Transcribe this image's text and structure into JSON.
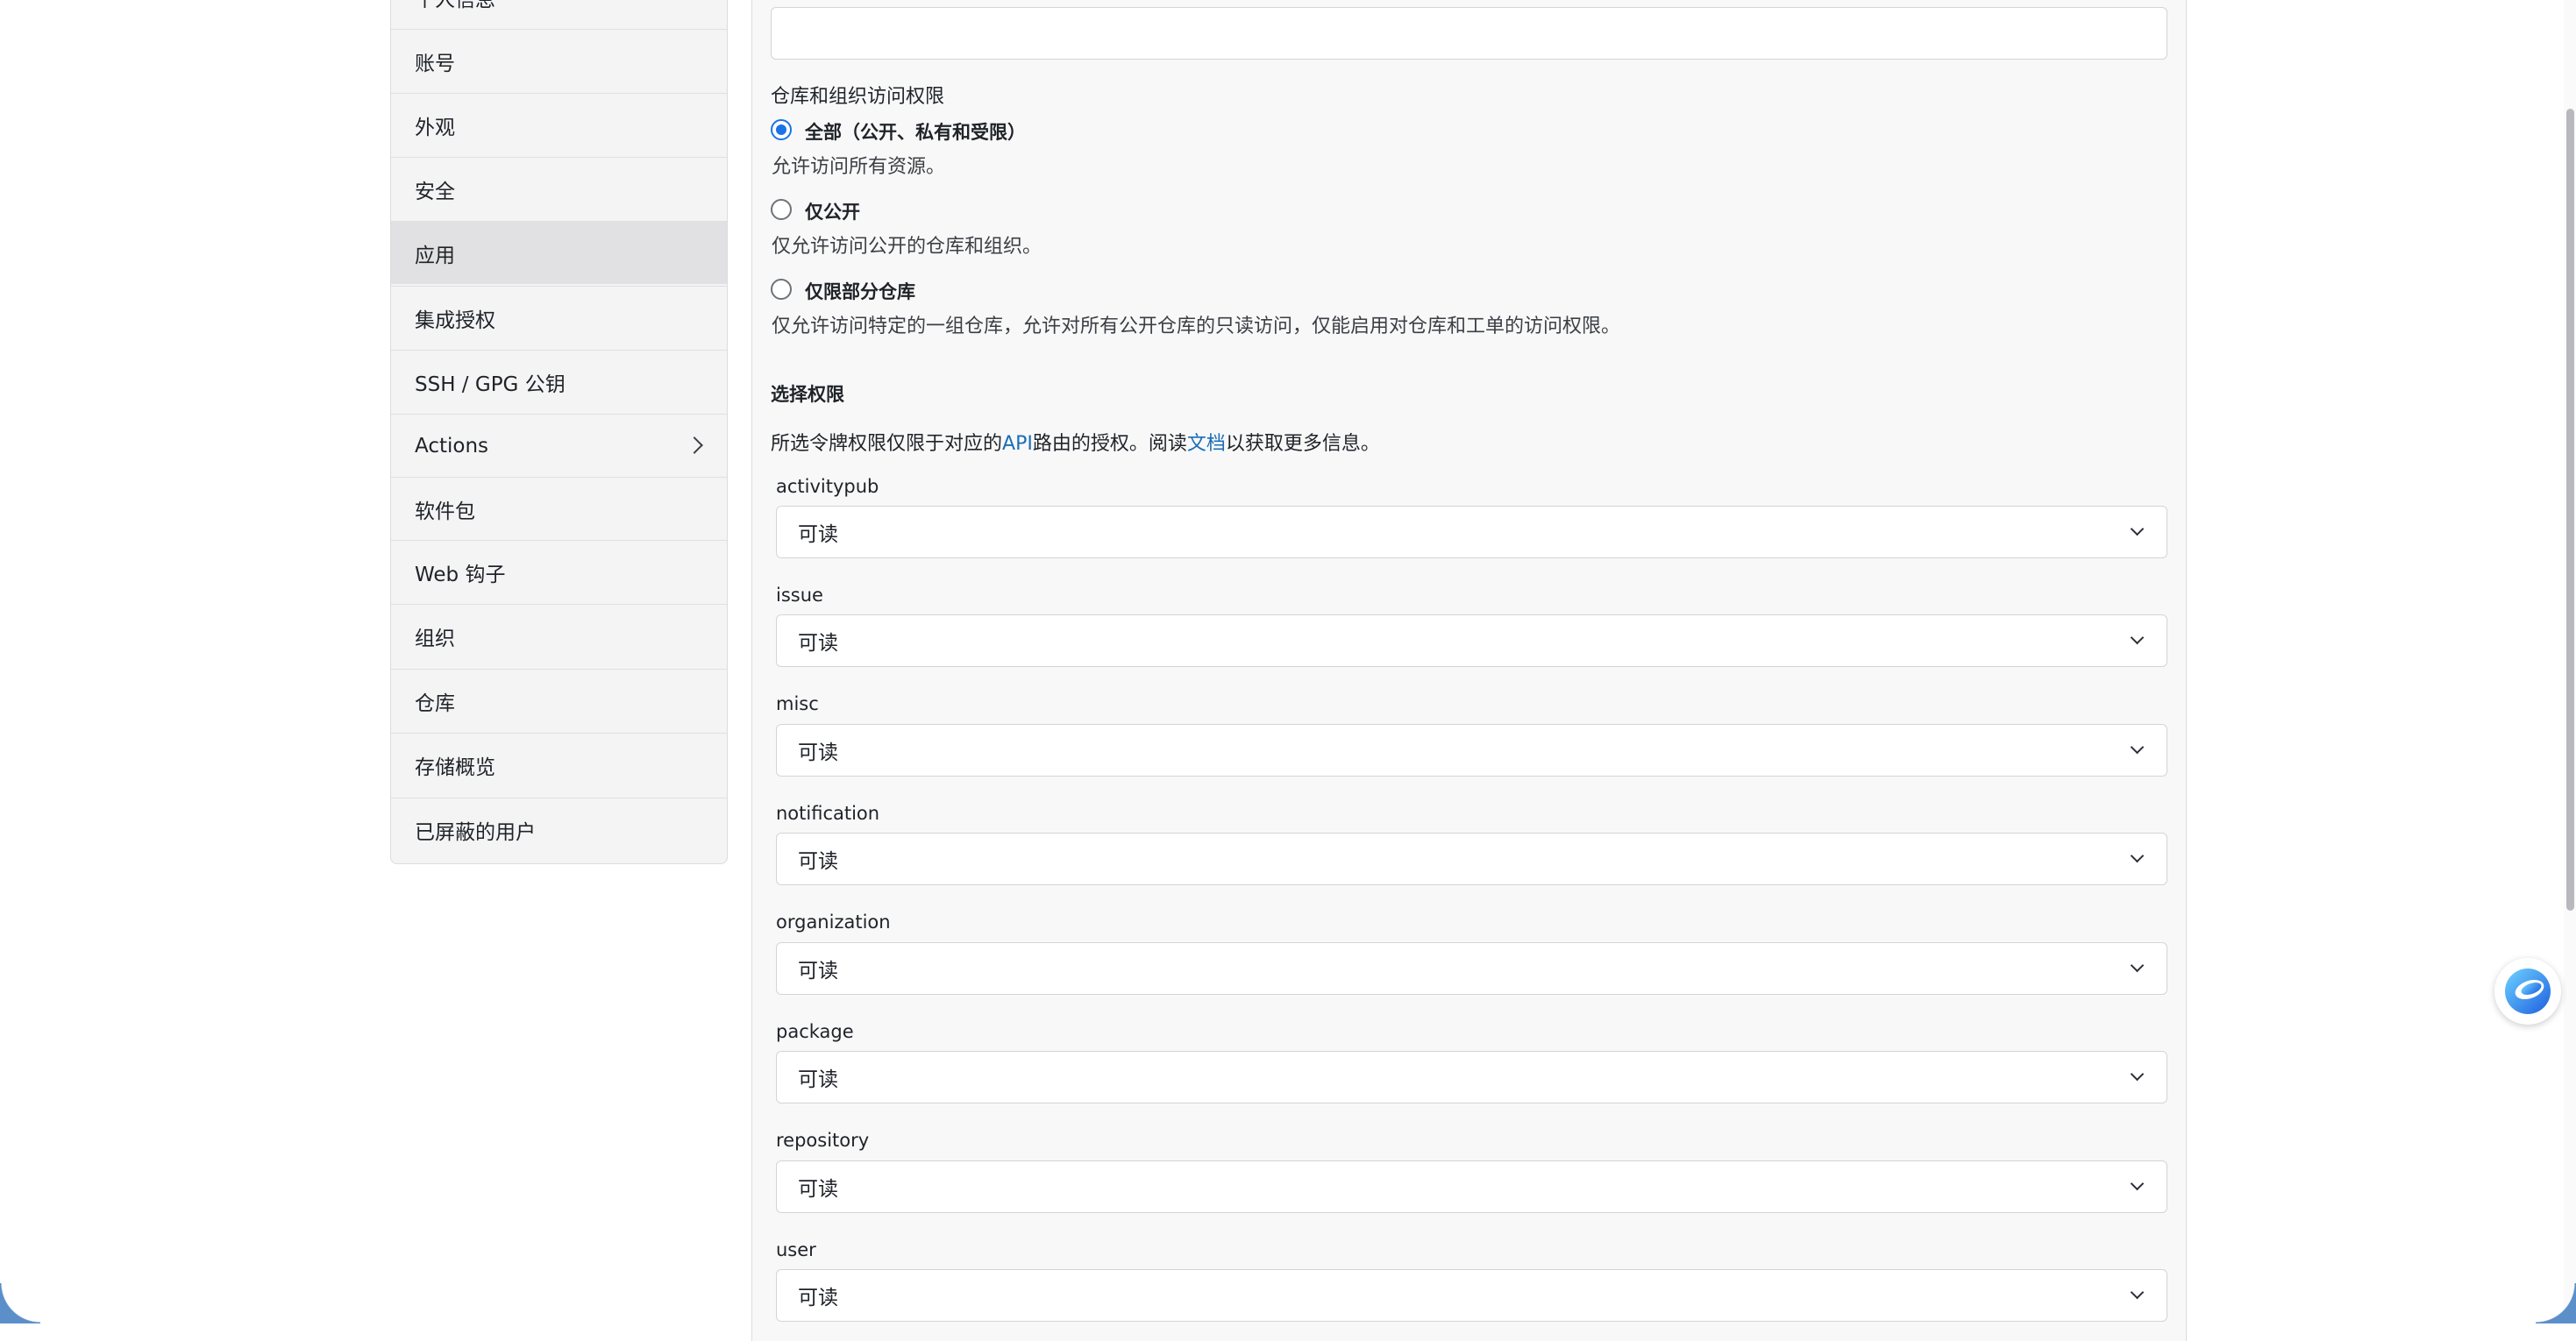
{
  "sidebar": {
    "items": [
      {
        "label": "个人信息"
      },
      {
        "label": "账号"
      },
      {
        "label": "外观"
      },
      {
        "label": "安全"
      },
      {
        "label": "应用"
      },
      {
        "label": "集成授权"
      },
      {
        "label": "SSH / GPG 公钥"
      },
      {
        "label": "Actions"
      },
      {
        "label": "软件包"
      },
      {
        "label": "Web 钩子"
      },
      {
        "label": "组织"
      },
      {
        "label": "仓库"
      },
      {
        "label": "存储概览"
      },
      {
        "label": "已屏蔽的用户"
      }
    ],
    "active": "应用"
  },
  "form": {
    "token_name_value": "",
    "access_heading": "仓库和组织访问权限",
    "options": [
      {
        "label": "全部（公开、私有和受限）",
        "desc": "允许访问所有资源。",
        "checked": true
      },
      {
        "label": "仅公开",
        "desc": "仅允许访问公开的仓库和组织。",
        "checked": false
      },
      {
        "label": "仅限部分仓库",
        "desc": "仅允许访问特定的一组仓库，允许对所有公开仓库的只读访问，仅能启用对仓库和工单的访问权限。",
        "checked": false
      }
    ],
    "perm_heading": "选择权限",
    "perm_desc": {
      "prefix": "所选令牌权限仅限于对应的",
      "api_link": "API",
      "middle": "路由的授权。阅读",
      "doc_link": "文档",
      "suffix": "以获取更多信息。"
    },
    "permissions": [
      {
        "name": "activitypub",
        "value": "可读"
      },
      {
        "name": "issue",
        "value": "可读"
      },
      {
        "name": "misc",
        "value": "可读"
      },
      {
        "name": "notification",
        "value": "可读"
      },
      {
        "name": "organization",
        "value": "可读"
      },
      {
        "name": "package",
        "value": "可读"
      },
      {
        "name": "repository",
        "value": "可读"
      },
      {
        "name": "user",
        "value": "可读"
      }
    ]
  },
  "colors": {
    "accent": "#1a73e8",
    "link": "#1c6eb6",
    "sidebar_bg": "#f4f4f5",
    "active_bg": "#e1e1e3"
  },
  "icons": {
    "actions_chevron": "chevron-right-icon",
    "select_caret": "chevron-down-icon",
    "float": "assistant-icon"
  }
}
